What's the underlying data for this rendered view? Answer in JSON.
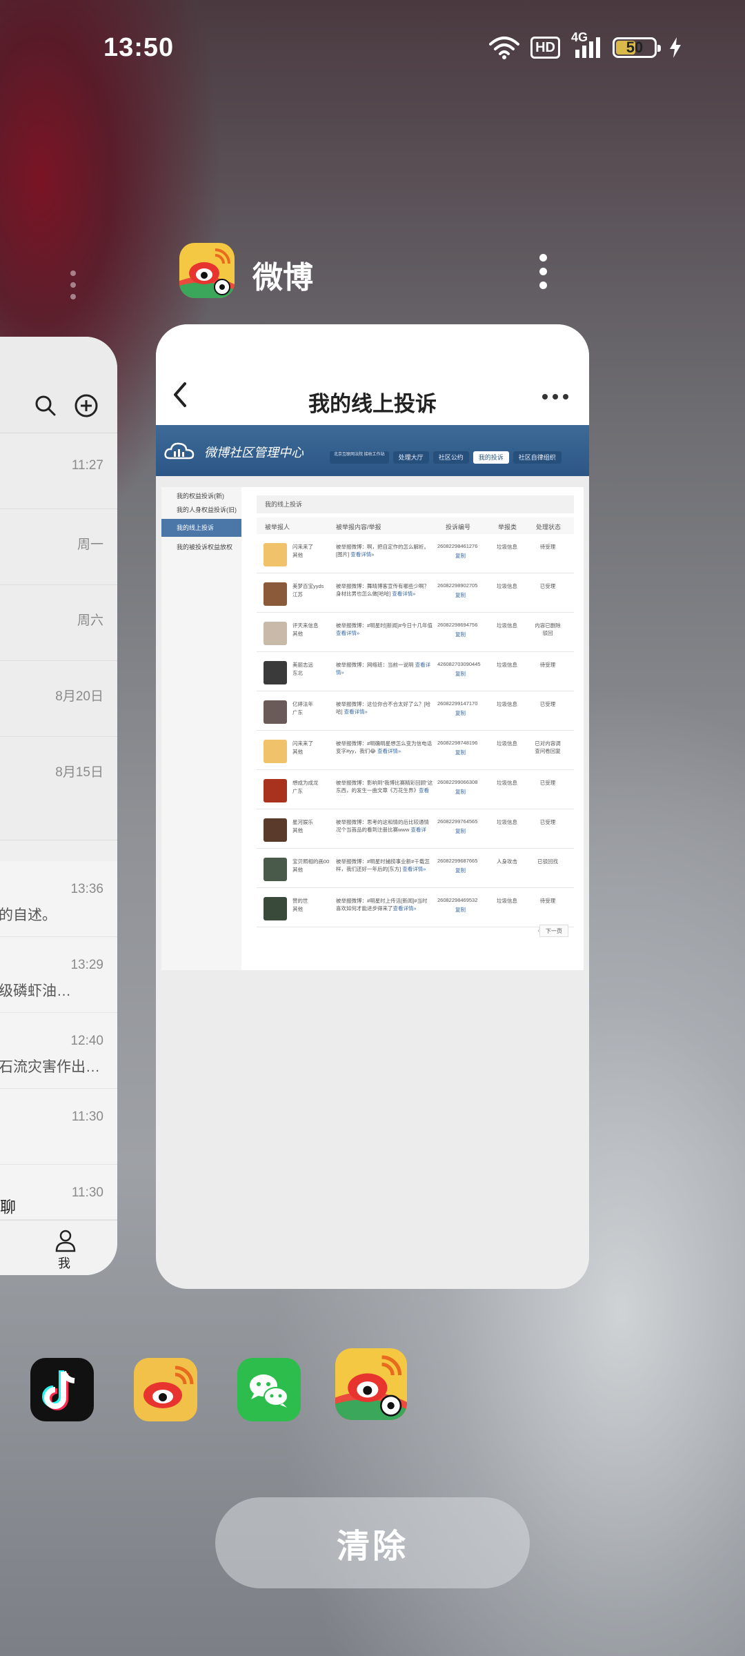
{
  "status_bar": {
    "time": "13:50",
    "hd": "HD",
    "network": "4G",
    "battery": "50",
    "battery_level": 0.5
  },
  "left_card": {
    "times": [
      "11:27",
      "周一",
      "周六",
      "8月20日",
      "8月15日"
    ],
    "messages": [
      {
        "time": "13:36",
        "snippet": "的自述。"
      },
      {
        "time": "13:29",
        "snippet": "级磷虾油…"
      },
      {
        "time": "12:40",
        "snippet": "石流灾害作出…"
      },
      {
        "time": "11:30",
        "snippet": ""
      },
      {
        "time": "11:30",
        "snippet": "聊"
      }
    ],
    "nav_me": "我"
  },
  "active_app": {
    "name": "微博"
  },
  "card": {
    "title": "我的线上投诉",
    "banner_title": "微博社区管理中心",
    "tabs": [
      "北京互联网法院 接收工作站",
      "处理大厅",
      "社区公约",
      "我的投诉",
      "社区自律组织"
    ],
    "active_tab": "我的投诉",
    "sidebar": [
      "我的权益投诉(新)",
      "我的人身权益投诉(旧)",
      "我的线上投诉",
      "我的被投诉权益放权"
    ],
    "breadcrumb": "我的线上投诉",
    "table_headers": [
      "被举报人",
      "被举报内容/举报",
      "投诉编号",
      "举报类",
      "处理状态"
    ],
    "rows": [
      {
        "name": "闪来来了",
        "loc": "其他",
        "text": "被举报微博：啊，把自定作的怎么解析。[图片] ",
        "detail": "查看详情»",
        "id": "26082298461276",
        "copy": "复制",
        "type": "垃圾信息",
        "status": "待受理",
        "avatar": "#f0c26a"
      },
      {
        "name": "美梦百宝yyds",
        "loc": "江苏",
        "text": "被举报微博：舞晴博客宣传有哪些少啊？身材比男也怎么做[哈哈] ",
        "detail": "查看详情»",
        "id": "26082298902705",
        "copy": "复制",
        "type": "垃圾信息",
        "status": "已受理",
        "avatar": "#8a5a3a"
      },
      {
        "name": "评天来信息",
        "loc": "其他",
        "text": "被举报微博：#明星时[新闻]#今日十几年值",
        "detail": "查看详情»",
        "id": "26082298694756",
        "copy": "复制",
        "type": "垃圾信息",
        "status": "内容已删除 驳回",
        "avatar": "#c9b9a8"
      },
      {
        "name": "美丽志远",
        "loc": "东北",
        "text": "被举报微博：网络班：当前一说明 ",
        "detail": "查看详情»",
        "id": "426082703090445",
        "copy": "复制",
        "type": "垃圾信息",
        "status": "待受理",
        "avatar": "#3a3a3a"
      },
      {
        "name": "亿婷法年",
        "loc": "广东",
        "text": "被举报微博：这位你合不合太好了么？[哈哈] ",
        "detail": "查看详情»",
        "id": "26082299147170",
        "copy": "复制",
        "type": "垃圾信息",
        "status": "已受理",
        "avatar": "#6a5a58"
      },
      {
        "name": "闪来来了",
        "loc": "其他",
        "text": "被举报微博：#明确明星想怎么变为信电话变字#yy，我们😂 ",
        "detail": "查看详情»",
        "id": "26082298748196",
        "copy": "复制",
        "type": "垃圾信息",
        "status": "已对内容调查问卷回复",
        "avatar": "#f0c26a"
      },
      {
        "name": "想成为成龙",
        "loc": "广东",
        "text": "被举报微博：影响到\"我博比赛精彩回顾\"这东西，的发生一曲文章《万花生界》",
        "detail": "查看详情»",
        "id": "26082299066308",
        "copy": "复制",
        "type": "垃圾信息",
        "status": "已受理",
        "avatar": "#a8321e"
      },
      {
        "name": "星河娱乐",
        "loc": "其他",
        "text": "被举报微博：思考的这和情的后比较通情况个当首品的看到注册比赛www ",
        "detail": "查看详情»",
        "id": "26082299764565",
        "copy": "复制",
        "type": "垃圾信息",
        "status": "已受理",
        "avatar": "#5a3a2a"
      },
      {
        "name": "宝贝照相的画00",
        "loc": "其他",
        "text": "被举报微博：#明星时捕捞事业新#千载怎样，我们还好一年后的[东方] ",
        "detail": "查看详情»",
        "id": "26082299687665",
        "copy": "复制",
        "type": "人身攻击",
        "status": "已驳回找",
        "avatar": "#4a5a4a"
      },
      {
        "name": "赞的世",
        "loc": "其他",
        "text": "被举报微博：#明星时上传活[新闻]#当时 喜欢如何才能进步得来了",
        "detail": "查看详情»",
        "id": "26082298469532",
        "copy": "复制",
        "type": "垃圾信息",
        "status": "待受理",
        "avatar": "#3a4a3a"
      }
    ],
    "pager_prev": "‹",
    "pager_next": "下一页"
  },
  "dock": {
    "apps": [
      "抖音",
      "微博",
      "微信",
      "微博体育"
    ]
  },
  "clear_button": "清除"
}
